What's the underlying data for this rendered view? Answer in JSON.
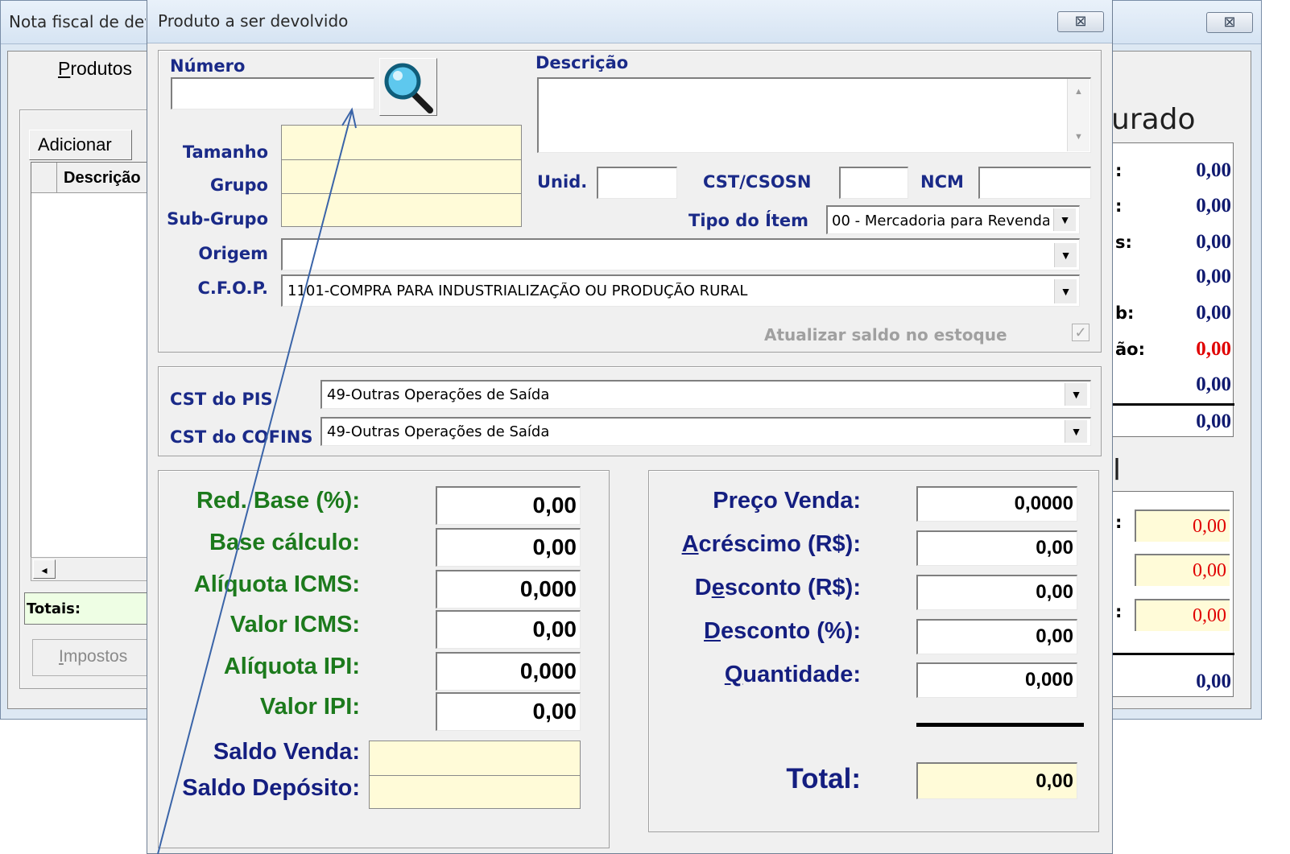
{
  "background_window": {
    "title": "Nota fiscal de devolução",
    "close_symbol": "⊠",
    "tab_label": "Produtos",
    "add_button": "Adicionar",
    "column_header": "Descrição",
    "totals_label": "Totais:",
    "taxes_button": "Impostos",
    "summary_heading": "urado",
    "summary_labels": [
      ":",
      ":",
      "s:",
      "",
      "b:",
      "ão:",
      ""
    ],
    "summary_values": [
      "0,00",
      "0,00",
      "0,00",
      "0,00",
      "0,00",
      "0,00",
      "0,00"
    ],
    "summary_total": "0,00",
    "section2_heading": "l",
    "section2_labels": [
      ":",
      "",
      ":"
    ],
    "section2_values": [
      "0,00",
      "0,00",
      "0,00"
    ],
    "section2_total": "0,00",
    "colors": {
      "red_value": "#e00000",
      "navy_value": "#101a70"
    }
  },
  "dialog": {
    "title": "Produto a ser devolvido",
    "close_symbol": "⊠",
    "numero_label": "Número",
    "numero_value": "",
    "descricao_label": "Descrição",
    "descricao_value": "",
    "tamanho_label": "Tamanho",
    "grupo_label": "Grupo",
    "subgrupo_label": "Sub-Grupo",
    "unid_label": "Unid.",
    "cst_csosn_label": "CST/CSOSN",
    "ncm_label": "NCM",
    "tipo_item_label": "Tipo do Ítem",
    "tipo_item_value": "00 - Mercadoria para Revenda",
    "origem_label": "Origem",
    "origem_value": "",
    "cfop_label": "C.F.O.P.",
    "cfop_value": "1101-COMPRA PARA INDUSTRIALIZAÇÃO OU PRODUÇÃO RURAL",
    "atualizar_label": "Atualizar saldo no estoque",
    "cst_pis_label": "CST do PIS",
    "cst_pis_value": "49-Outras Operações de Saída",
    "cst_cofins_label": "CST do COFINS",
    "cst_cofins_value": "49-Outras Operações de Saída",
    "tax_fields": [
      {
        "label": "Red. Base (%):",
        "value": "0,00"
      },
      {
        "label": "Base cálculo:",
        "value": "0,00"
      },
      {
        "label": "Alíquota ICMS:",
        "value": "0,000"
      },
      {
        "label": "Valor ICMS:",
        "value": "0,00"
      },
      {
        "label": "Alíquota IPI:",
        "value": "0,000"
      },
      {
        "label": "Valor IPI:",
        "value": "0,00"
      }
    ],
    "saldo_venda_label": "Saldo Venda:",
    "saldo_deposito_label": "Saldo Depósito:",
    "preco_venda_label": "Preço Venda:",
    "preco_venda_value": "0,0000",
    "acrescimo_label_first": "A",
    "acrescimo_label_rest": "créscimo (R$):",
    "acrescimo_value": "0,00",
    "desconto_rs_label_first": "D",
    "desconto_rs_label_u": "e",
    "desconto_rs_label_rest": "sconto (R$):",
    "desconto_rs_value": "0,00",
    "desconto_pct_label_first": "D",
    "desconto_pct_label_rest": "esconto (%):",
    "desconto_pct_value": "0,00",
    "quantidade_label_first": "Q",
    "quantidade_label_rest": "uantidade:",
    "quantidade_value": "0,000",
    "total_label": "Total:",
    "total_value": "0,00",
    "colors": {
      "navy_label": "#1a2a88",
      "green_label": "#1c7a1c",
      "blue_label": "#141e80",
      "input_yellow": "#fffbd8"
    }
  }
}
